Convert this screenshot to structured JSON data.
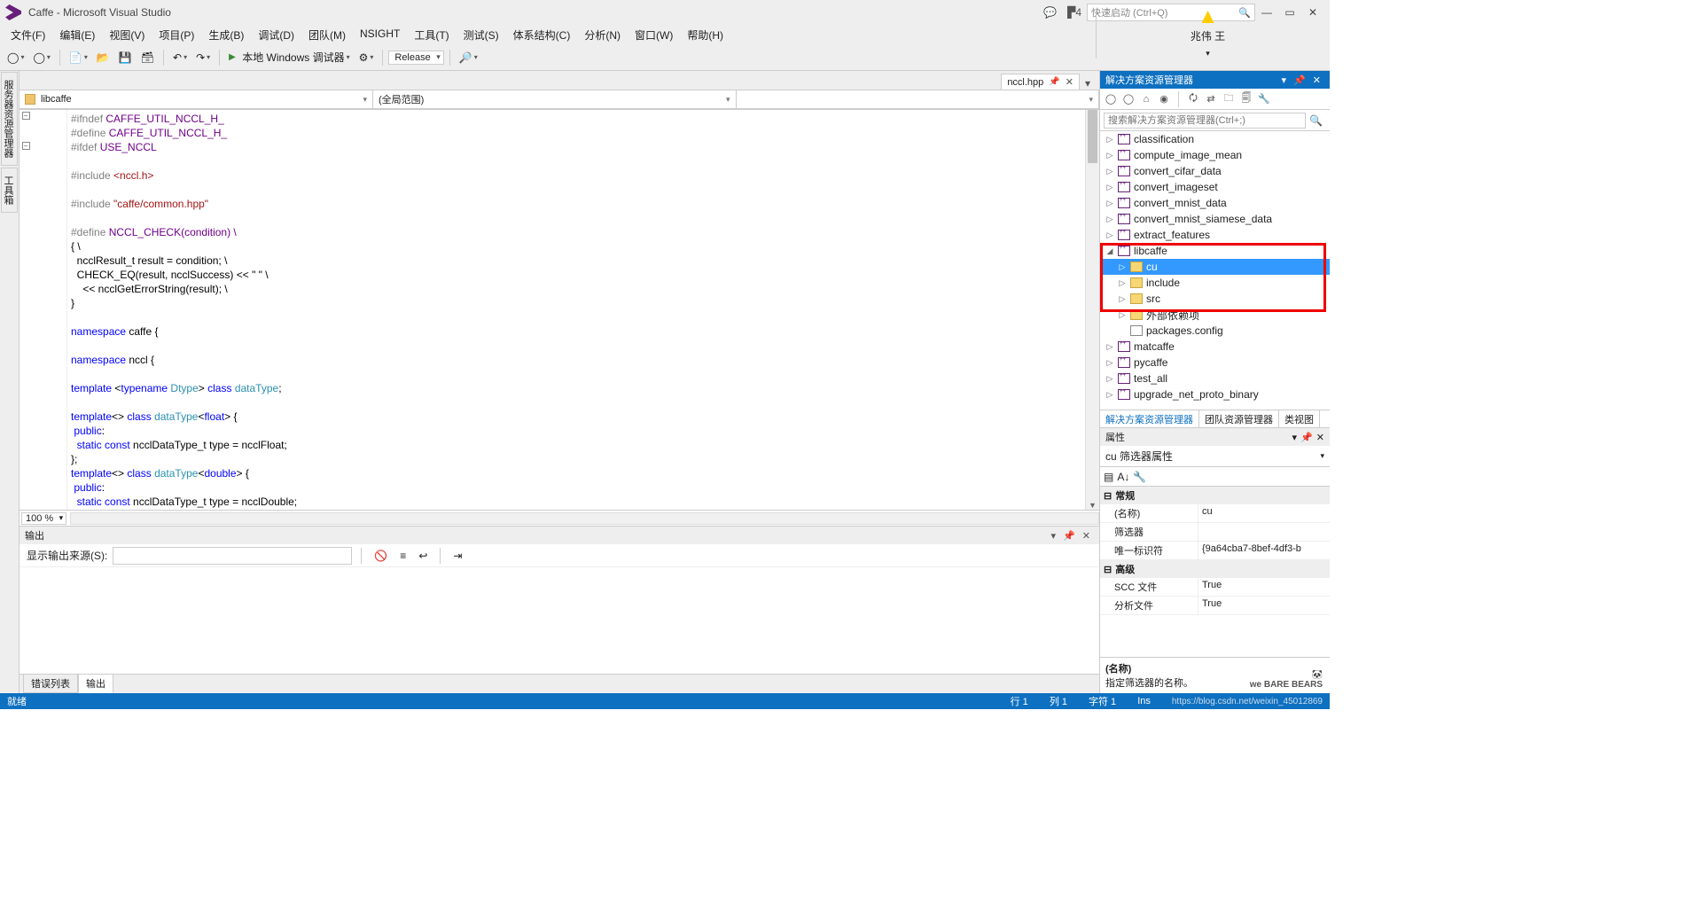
{
  "title": "Caffe - Microsoft Visual Studio",
  "notification_count": "4",
  "quick_launch_placeholder": "快速启动 (Ctrl+Q)",
  "user_name": "兆伟 王",
  "menu": [
    "文件(F)",
    "编辑(E)",
    "视图(V)",
    "项目(P)",
    "生成(B)",
    "调试(D)",
    "团队(M)",
    "NSIGHT",
    "工具(T)",
    "测试(S)",
    "体系结构(C)",
    "分析(N)",
    "窗口(W)",
    "帮助(H)"
  ],
  "debug_target": "本地 Windows 调试器",
  "configuration": "Release",
  "left_tabs": [
    "服务器资源管理器",
    "工具箱"
  ],
  "doc_tab": {
    "name": "nccl.hpp"
  },
  "nav": {
    "project": "libcaffe",
    "scope": "(全局范围)"
  },
  "zoom": "100 %",
  "output": {
    "title": "输出",
    "source_label": "显示输出来源(S):",
    "tabs": [
      "错误列表",
      "输出"
    ]
  },
  "solution_explorer": {
    "title": "解决方案资源管理器",
    "search_placeholder": "搜索解决方案资源管理器(Ctrl+;)",
    "projects": [
      "classification",
      "compute_image_mean",
      "convert_cifar_data",
      "convert_imageset",
      "convert_mnist_data",
      "convert_mnist_siamese_data",
      "extract_features"
    ],
    "libcaffe": {
      "name": "libcaffe",
      "folders": [
        "cu",
        "include",
        "src"
      ],
      "ext": "外部依赖项",
      "pkg": "packages.config"
    },
    "projects2": [
      "matcaffe",
      "pycaffe",
      "test_all",
      "upgrade_net_proto_binary"
    ],
    "tabs": [
      "解决方案资源管理器",
      "团队资源管理器",
      "类视图"
    ]
  },
  "properties": {
    "title": "属性",
    "object": "cu 筛选器属性",
    "cat1": "常规",
    "rows1": [
      {
        "k": "(名称)",
        "v": "cu"
      },
      {
        "k": "筛选器",
        "v": ""
      },
      {
        "k": "唯一标识符",
        "v": "{9a64cba7-8bef-4df3-b"
      }
    ],
    "cat2": "高级",
    "rows2": [
      {
        "k": "SCC 文件",
        "v": "True"
      },
      {
        "k": "分析文件",
        "v": "True"
      }
    ],
    "desc_name": "(名称)",
    "desc_text": "指定筛选器的名称。"
  },
  "status": {
    "ready": "就绪",
    "line": "行 1",
    "col": "列 1",
    "char": "字符 1",
    "ins": "Ins"
  },
  "watermark": "https://blog.csdn.net/weixin_45012869",
  "code_lines": [
    {
      "t": "#ifndef CAFFE_UTIL_NCCL_H_",
      "c": "pp",
      "o": "-"
    },
    {
      "t": "#define CAFFE_UTIL_NCCL_H_",
      "c": "mac"
    },
    {
      "t": "#ifdef USE_NCCL",
      "c": "pp",
      "o": "-"
    },
    {
      "t": ""
    },
    {
      "t": "#include <nccl.h>",
      "c": "inc"
    },
    {
      "t": ""
    },
    {
      "t": "#include \"caffe/common.hpp\"",
      "c": "inc2"
    },
    {
      "t": ""
    },
    {
      "t": "#define NCCL_CHECK(condition) \\",
      "c": "mac"
    },
    {
      "t": "{ \\"
    },
    {
      "t": "  ncclResult_t result = condition; \\"
    },
    {
      "t": "  CHECK_EQ(result, ncclSuccess) << \" \" \\"
    },
    {
      "t": "    << ncclGetErrorString(result); \\"
    },
    {
      "t": "}"
    },
    {
      "t": ""
    },
    {
      "t": "namespace caffe {",
      "c": "kw"
    },
    {
      "t": ""
    },
    {
      "t": "namespace nccl {",
      "c": "kw"
    },
    {
      "t": ""
    },
    {
      "t": "template <typename Dtype> class dataType;",
      "c": "tmpl"
    },
    {
      "t": ""
    },
    {
      "t": "template<> class dataType<float> {",
      "c": "tmpl2"
    },
    {
      "t": " public:",
      "c": "kw"
    },
    {
      "t": "  static const ncclDataType_t type = ncclFloat;",
      "c": "st"
    },
    {
      "t": "};"
    },
    {
      "t": "template<> class dataType<double> {",
      "c": "tmpl3"
    },
    {
      "t": " public:",
      "c": "kw"
    },
    {
      "t": "  static const ncclDataType_t type = ncclDouble;",
      "c": "st"
    }
  ]
}
